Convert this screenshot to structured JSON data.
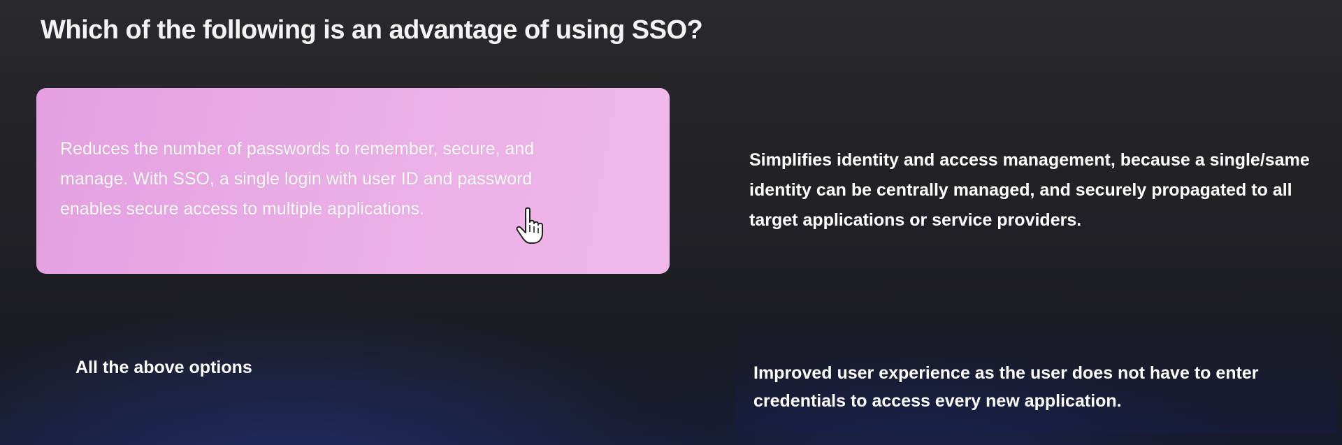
{
  "question": "Which of the following is an advantage of using SSO?",
  "options": [
    {
      "text": "Reduces the number of passwords to remember, secure, and manage. With SSO, a single login with user ID and password enables secure access to multiple applications."
    },
    {
      "text": "Simplifies identity and access management, because a single/same identity can be centrally managed, and securely propagated to all target applications or service providers."
    },
    {
      "text": "All the above options"
    },
    {
      "text": "Improved user experience as the user does not have to enter credentials to access every new application."
    }
  ],
  "icons": {
    "cursor": "hand-pointer-icon"
  },
  "colors": {
    "selected_option": "#eaaee6"
  }
}
